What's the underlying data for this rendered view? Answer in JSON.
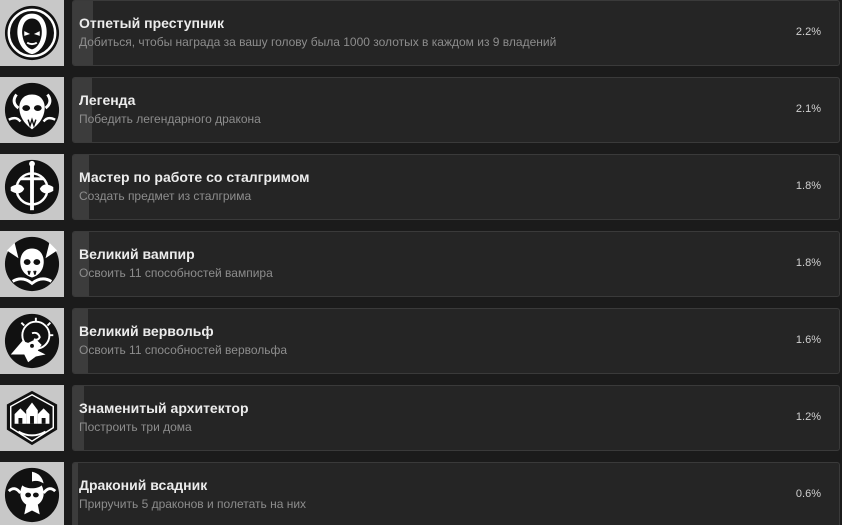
{
  "achievements": [
    {
      "title": "Отпетый преступник",
      "description": "Добиться, чтобы награда за вашу голову была 1000 золотых в каждом из 9 владений",
      "percent": "2.2%",
      "progress_fraction": 0.022,
      "icon": "hooded-face-icon"
    },
    {
      "title": "Легенда",
      "description": "Победить легендарного дракона",
      "percent": "2.1%",
      "progress_fraction": 0.021,
      "icon": "dragon-skull-icon"
    },
    {
      "title": "Мастер по работе со сталгримом",
      "description": "Создать предмет из сталгрима",
      "percent": "1.8%",
      "progress_fraction": 0.018,
      "icon": "sword-emblem-icon"
    },
    {
      "title": "Великий вампир",
      "description": "Освоить 11 способностей вампира",
      "percent": "1.8%",
      "progress_fraction": 0.018,
      "icon": "vampire-skull-icon"
    },
    {
      "title": "Великий вервольф",
      "description": "Освоить 11 способностей вервольфа",
      "percent": "1.6%",
      "progress_fraction": 0.016,
      "icon": "werewolf-head-icon"
    },
    {
      "title": "Знаменитый архитектор",
      "description": "Построить три дома",
      "percent": "1.2%",
      "progress_fraction": 0.012,
      "icon": "houses-emblem-icon"
    },
    {
      "title": "Драконий всадник",
      "description": "Приручить 5 драконов и полетать на них",
      "percent": "0.6%",
      "progress_fraction": 0.006,
      "icon": "dragon-rider-icon"
    }
  ]
}
